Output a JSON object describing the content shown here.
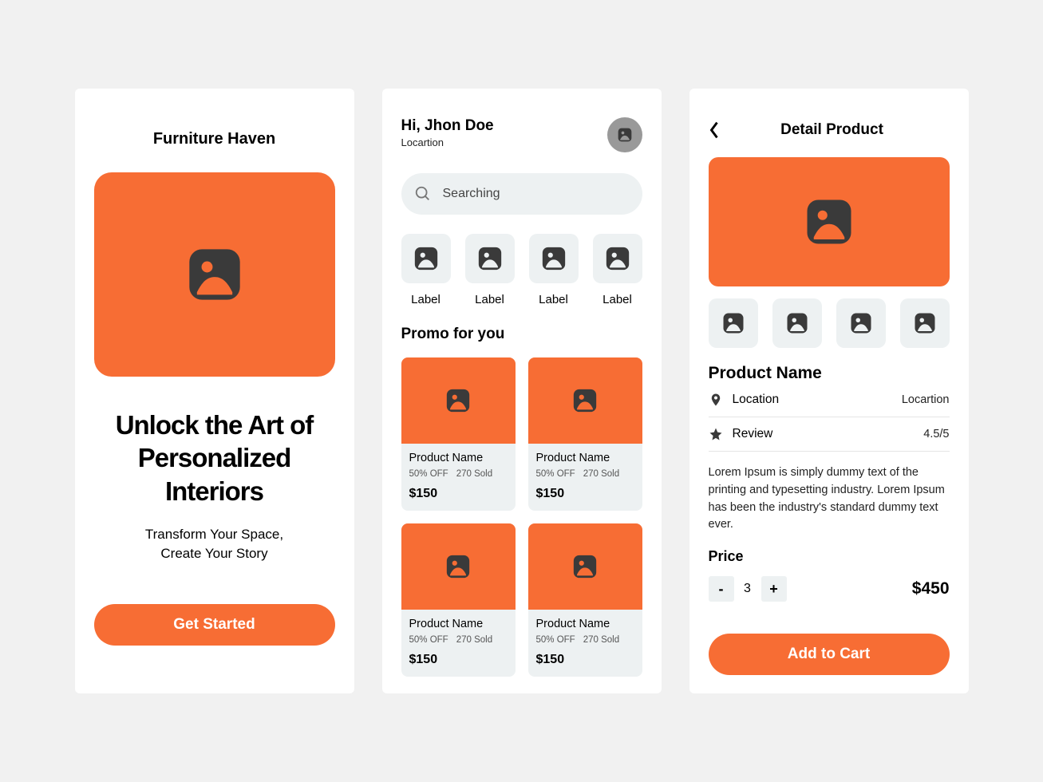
{
  "screen1": {
    "brand": "Furniture Haven",
    "headline": "Unlock the Art of Personalized Interiors",
    "subtitle_line1": "Transform Your Space,",
    "subtitle_line2": "Create Your Story",
    "cta": "Get Started"
  },
  "screen2": {
    "greeting": "Hi, Jhon Doe",
    "location": "Locartion",
    "search_placeholder": "Searching",
    "categories": [
      {
        "label": "Label"
      },
      {
        "label": "Label"
      },
      {
        "label": "Label"
      },
      {
        "label": "Label"
      }
    ],
    "section_title": "Promo for you",
    "products": [
      {
        "name": "Product Name",
        "discount": "50% OFF",
        "sold": "270 Sold",
        "price": "$150"
      },
      {
        "name": "Product Name",
        "discount": "50% OFF",
        "sold": "270 Sold",
        "price": "$150"
      },
      {
        "name": "Product Name",
        "discount": "50% OFF",
        "sold": "270 Sold",
        "price": "$150"
      },
      {
        "name": "Product Name",
        "discount": "50% OFF",
        "sold": "270 Sold",
        "price": "$150"
      }
    ]
  },
  "screen3": {
    "title": "Detail Product",
    "product_name": "Product Name",
    "location_label": "Location",
    "location_value": "Locartion",
    "review_label": "Review",
    "review_value": "4.5/5",
    "description": "Lorem Ipsum is simply dummy text of the printing and typesetting industry. Lorem Ipsum has been the industry's standard dummy text ever.",
    "price_label": "Price",
    "quantity": "3",
    "price_value": "$450",
    "cta": "Add to Cart"
  }
}
